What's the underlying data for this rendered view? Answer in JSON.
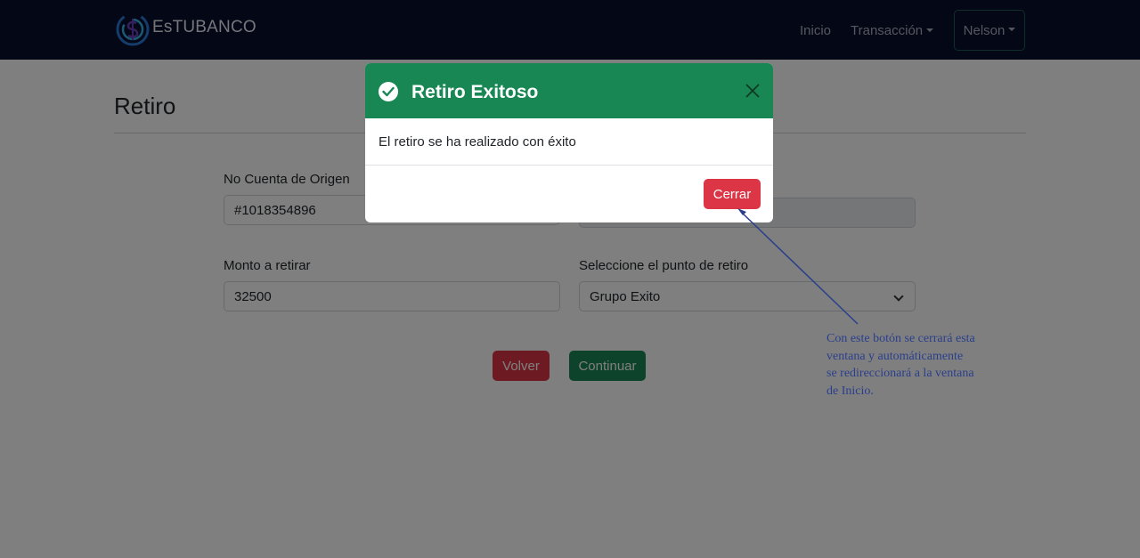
{
  "navbar": {
    "brand": "EsTUBANCO",
    "links": {
      "inicio": "Inicio",
      "transaccion": "Transacción"
    },
    "user": "Nelson"
  },
  "page": {
    "title": "Retiro",
    "fields": {
      "origin_account_label": "No Cuenta de Origen",
      "origin_account_value": "#1018354896",
      "amount_label": "Monto a retirar",
      "amount_value": "32500",
      "point_label": "Seleccione el punto de retiro",
      "point_value": "Grupo Exito"
    },
    "buttons": {
      "back": "Volver",
      "continue": "Continuar"
    }
  },
  "modal": {
    "title": "Retiro Exitoso",
    "body": "El retiro se ha realizado con éxito",
    "close_button": "Cerrar"
  },
  "annotation": {
    "text": "Con este botón se cerrará esta\nventana  y automáticamente\n se redireccionará  a la ventana\nde Inicio."
  },
  "colors": {
    "navbar": "#060e2c",
    "success": "#198754",
    "danger": "#dc3545",
    "annotation": "#2a3f8c"
  }
}
